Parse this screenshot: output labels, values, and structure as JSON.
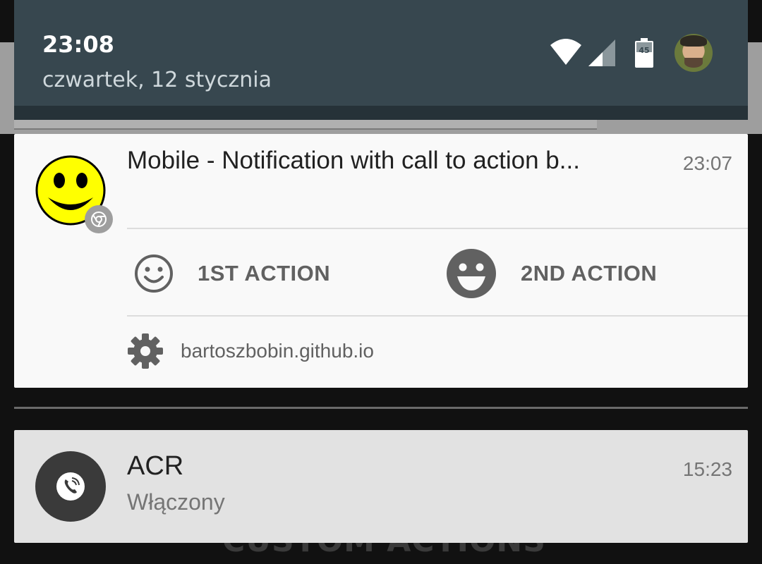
{
  "status": {
    "time": "23:08",
    "date": "czwartek, 12 stycznia",
    "battery_level": "45",
    "icons": [
      "wifi-icon",
      "cellular-signal-icon",
      "battery-icon",
      "user-avatar"
    ]
  },
  "background": {
    "ghost_text": "CUSTOM ACTIONS"
  },
  "notification_web": {
    "title": "Mobile - Notification with call to action b...",
    "time": "23:07",
    "app_icon": "smiley-icon",
    "badge_icon": "chrome-icon",
    "actions": [
      {
        "label": "1ST ACTION",
        "icon": "smiley-outline-icon"
      },
      {
        "label": "2ND ACTION",
        "icon": "smiley-filled-icon"
      }
    ],
    "site": "bartoszbobin.github.io",
    "site_icon": "gear-icon"
  },
  "notification_acr": {
    "title": "ACR",
    "subtitle": "Włączony",
    "time": "15:23",
    "icon": "phone-icon"
  },
  "colors": {
    "header_bg": "#37474f",
    "card_bg": "#f9f9f9",
    "card2_bg": "#e2e2e2",
    "smiley_yellow": "#ffff00",
    "action_grey": "#616161"
  }
}
